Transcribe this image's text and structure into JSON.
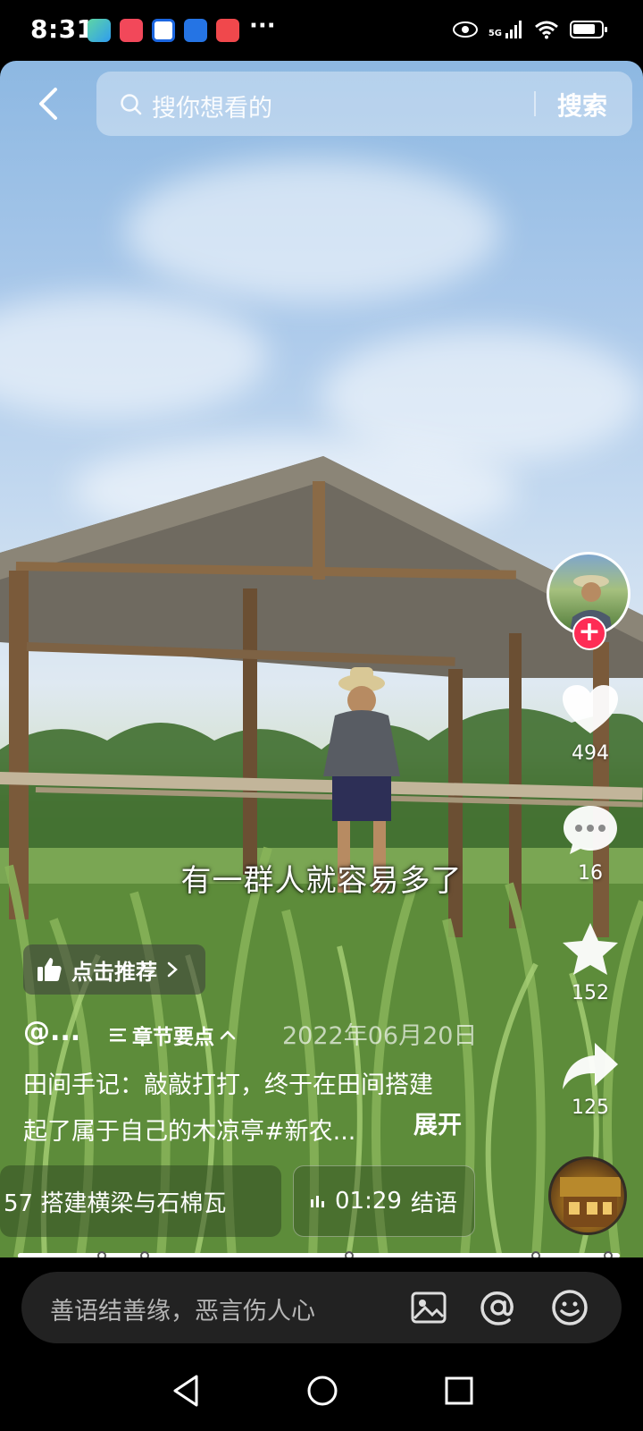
{
  "status_bar": {
    "time": "8:31",
    "network": "5G",
    "more": "···"
  },
  "search": {
    "placeholder": "搜你想看的",
    "button_label": "搜索"
  },
  "actions": {
    "likes": "494",
    "comments": "16",
    "favorites": "152",
    "shares": "125"
  },
  "video": {
    "subtitle": "有一群人就容易多了",
    "recommend_label": "点击推荐",
    "author": "@...",
    "chapters_label": "章节要点",
    "date": "2022年06月20日",
    "caption_line1": "田间手记：敲敲打打，终于在田间搭建",
    "caption_line2": "起了属于自己的木凉亭#新农...",
    "expand_label": "展开"
  },
  "chapter_chips": [
    {
      "label": "57  搭建横梁与石棉瓦"
    },
    {
      "time": "01:29",
      "label": "结语"
    }
  ],
  "progress": {
    "fraction": 0.98,
    "chapter_marks": [
      0.14,
      0.21,
      0.55,
      0.86,
      0.98
    ]
  },
  "comment_bar": {
    "placeholder": "善语结善缘，恶言伤人心"
  },
  "colors": {
    "follow_accent": "#fe2c55"
  }
}
